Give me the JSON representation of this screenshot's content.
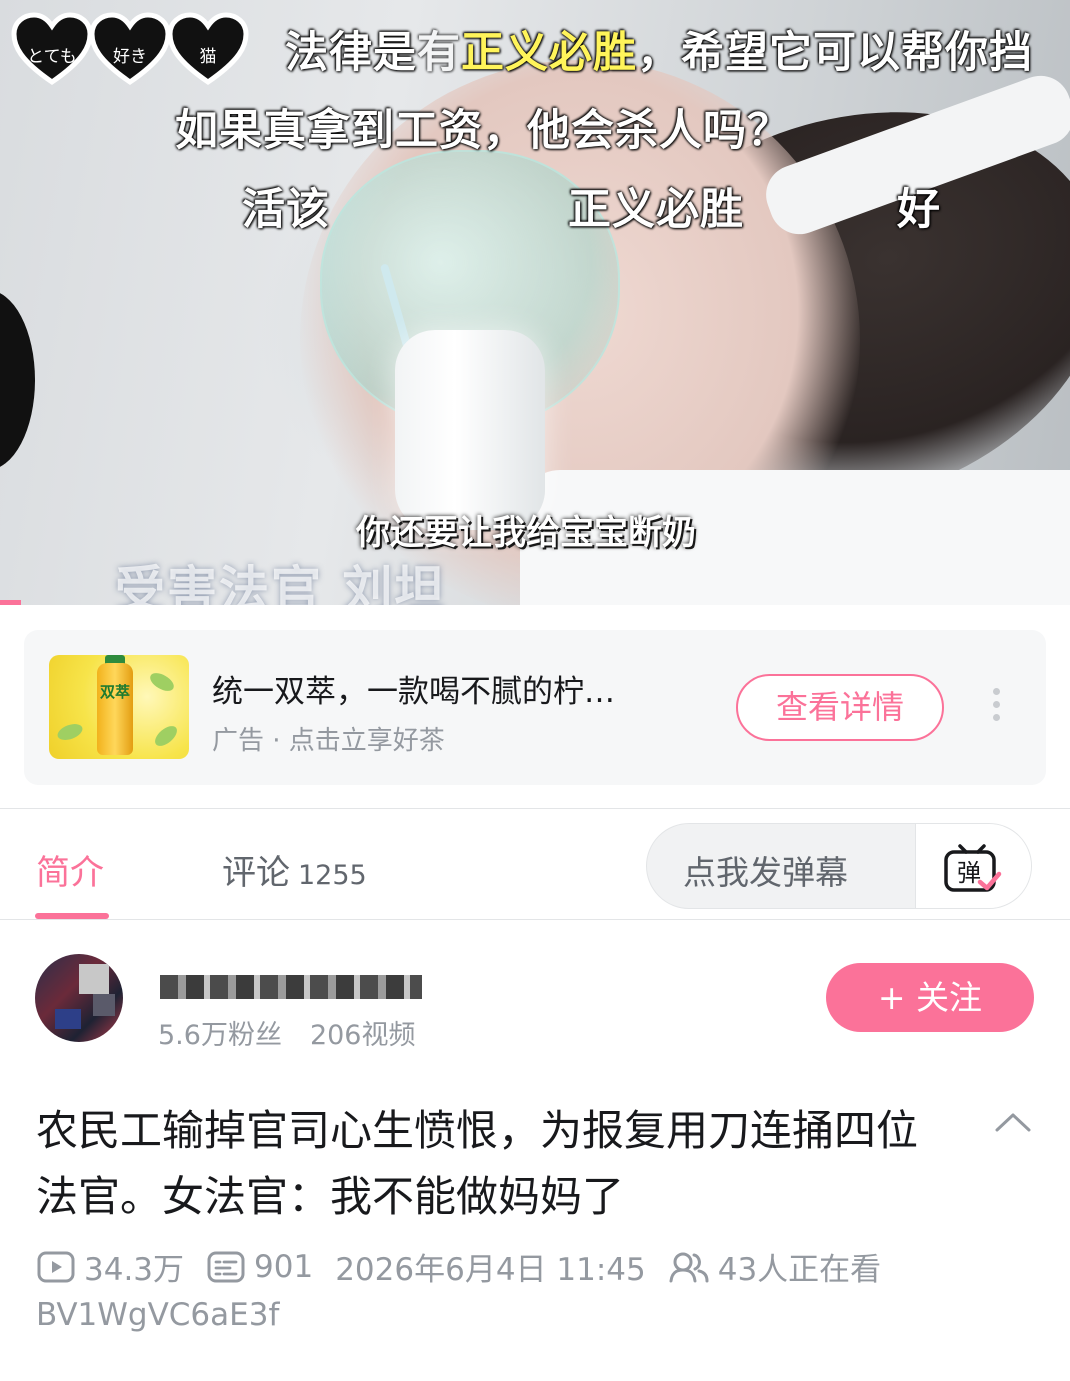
{
  "video": {
    "logo_texts": [
      "とても",
      "好き",
      "猫"
    ],
    "danmaku": [
      {
        "pre": "法律是",
        "mid": "有",
        "hl": "正义必胜",
        "post": "，希望它可以帮你挡"
      },
      {
        "text": "如果真拿到工资，他会杀人吗？"
      },
      {
        "text": "活该"
      },
      {
        "text": "正义必胜"
      },
      {
        "text": "好"
      }
    ],
    "subtitle": "你还要让我给宝宝断奶",
    "caption": "受害法官 刘坦",
    "progress": 0.02
  },
  "ad": {
    "title": "统一双萃，一款喝不腻的柠…",
    "subtitle": "广告 · 点击立享好茶",
    "button": "查看详情",
    "thumb_label": "双萃"
  },
  "tabs": {
    "intro": "简介",
    "comments": "评论",
    "comments_count": "1255",
    "danmaku_placeholder": "点我发弹幕",
    "danmaku_icon_label": "弹"
  },
  "uploader": {
    "name": "▇▇▇▇▇▇",
    "fans": "5.6万粉丝",
    "videos": "206视频",
    "follow": "+ 关注"
  },
  "video_info": {
    "title": "农民工输掉官司心生愤恨，为报复用刀连捅四位法官。女法官：我不能做妈妈了",
    "views": "34.3万",
    "danmaku_count": "901",
    "date": "2026年6月4日 11:45",
    "watching": "43人正在看",
    "bvid": "BV1WgVC6aE3f"
  },
  "colors": {
    "accent": "#fb7299",
    "text_secondary": "#9499a0"
  },
  "icons": [
    "play-count-icon",
    "danmaku-count-icon",
    "watching-icon",
    "chevron-up-icon",
    "more-vert-icon",
    "danmaku-send-icon"
  ]
}
